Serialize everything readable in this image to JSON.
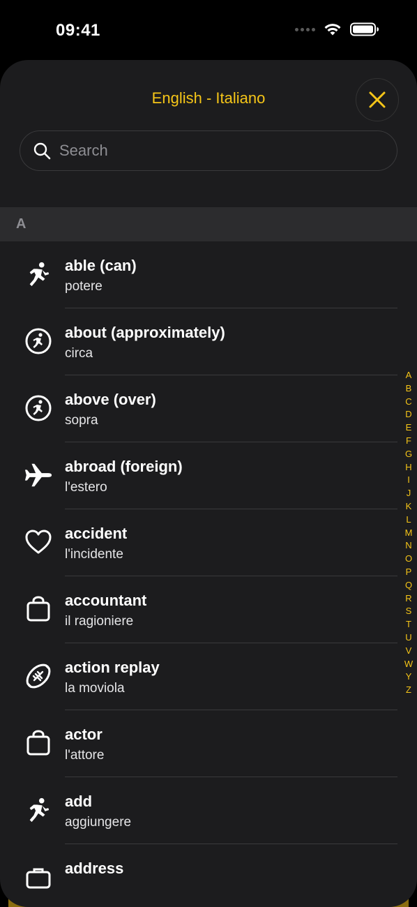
{
  "status": {
    "time": "09:41"
  },
  "header": {
    "title": "English - Italiano"
  },
  "search": {
    "placeholder": "Search"
  },
  "section": {
    "letter": "A"
  },
  "rows": [
    {
      "en": "able (can)",
      "it": "potere",
      "icon": "running-person-icon"
    },
    {
      "en": "about (approximately)",
      "it": "circa",
      "icon": "running-person-circle-icon"
    },
    {
      "en": "above (over)",
      "it": "sopra",
      "icon": "running-person-circle-icon"
    },
    {
      "en": "abroad (foreign)",
      "it": "l'estero",
      "icon": "airplane-icon"
    },
    {
      "en": "accident",
      "it": "l'incidente",
      "icon": "heart-icon"
    },
    {
      "en": "accountant",
      "it": "il ragioniere",
      "icon": "bag-icon"
    },
    {
      "en": "action replay",
      "it": "la moviola",
      "icon": "football-icon"
    },
    {
      "en": "actor",
      "it": "l'attore",
      "icon": "bag-icon"
    },
    {
      "en": "add",
      "it": "aggiungere",
      "icon": "running-person-icon"
    },
    {
      "en": "address",
      "it": "",
      "icon": "briefcase-icon"
    }
  ],
  "index_letters": [
    "A",
    "B",
    "C",
    "D",
    "E",
    "F",
    "G",
    "H",
    "I",
    "J",
    "K",
    "L",
    "M",
    "N",
    "O",
    "P",
    "Q",
    "R",
    "S",
    "T",
    "U",
    "V",
    "W",
    "Y",
    "Z"
  ],
  "colors": {
    "accent": "#f5c518",
    "background": "#1c1c1e",
    "section": "#2c2c2e"
  }
}
